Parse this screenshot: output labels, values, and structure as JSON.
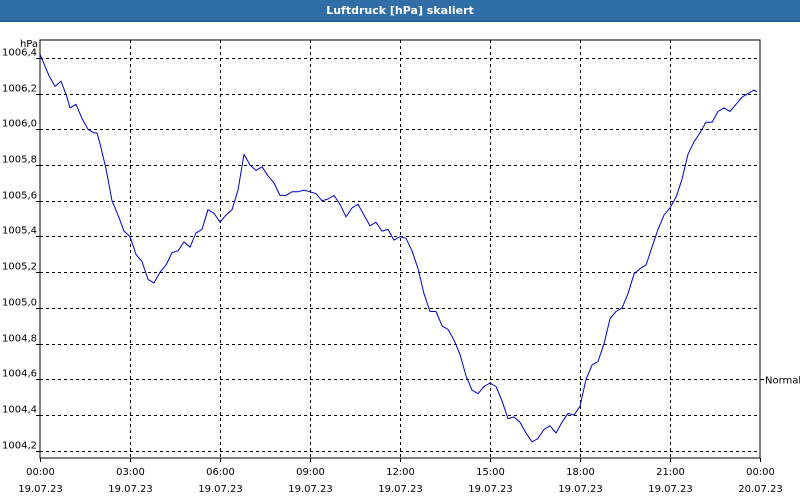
{
  "chart_data": {
    "type": "line",
    "title": "Luftdruck [hPa] skaliert",
    "ylabel": "hPa",
    "xlabel": "",
    "ylim": [
      1004.16,
      1006.5
    ],
    "xlim": [
      0,
      24
    ],
    "grid": true,
    "x_ticks": [
      {
        "t": 0,
        "time": "00:00",
        "date": "19.07.23"
      },
      {
        "t": 3,
        "time": "03:00",
        "date": "19.07.23"
      },
      {
        "t": 6,
        "time": "06:00",
        "date": "19.07.23"
      },
      {
        "t": 9,
        "time": "09:00",
        "date": "19.07.23"
      },
      {
        "t": 12,
        "time": "12:00",
        "date": "19.07.23"
      },
      {
        "t": 15,
        "time": "15:00",
        "date": "19.07.23"
      },
      {
        "t": 18,
        "time": "18:00",
        "date": "19.07.23"
      },
      {
        "t": 21,
        "time": "21:00",
        "date": "19.07.23"
      },
      {
        "t": 24,
        "time": "00:00",
        "date": "20.07.23"
      }
    ],
    "y_ticks": [
      {
        "v": 1004.2,
        "label": "1004,2"
      },
      {
        "v": 1004.4,
        "label": "1004,4"
      },
      {
        "v": 1004.6,
        "label": "1004,6"
      },
      {
        "v": 1004.8,
        "label": "1004,8"
      },
      {
        "v": 1005.0,
        "label": "1005,0"
      },
      {
        "v": 1005.2,
        "label": "1005,2"
      },
      {
        "v": 1005.4,
        "label": "1005,4"
      },
      {
        "v": 1005.6,
        "label": "1005,6"
      },
      {
        "v": 1005.8,
        "label": "1005,8"
      },
      {
        "v": 1006.0,
        "label": "1006,0"
      },
      {
        "v": 1006.2,
        "label": "1006,2"
      },
      {
        "v": 1006.4,
        "label": "1006,4"
      }
    ],
    "reference_line": {
      "value": 1004.6,
      "label": "Normal"
    },
    "series": [
      {
        "color": "#0000cc",
        "x": [
          0.0,
          0.1,
          0.3,
          0.5,
          0.7,
          0.9,
          1.0,
          1.2,
          1.4,
          1.6,
          1.8,
          1.9,
          2.0,
          2.2,
          2.4,
          2.6,
          2.8,
          3.0,
          3.2,
          3.4,
          3.6,
          3.8,
          4.0,
          4.2,
          4.4,
          4.6,
          4.8,
          5.0,
          5.2,
          5.4,
          5.6,
          5.8,
          6.0,
          6.2,
          6.4,
          6.6,
          6.8,
          7.0,
          7.2,
          7.4,
          7.6,
          7.8,
          8.0,
          8.2,
          8.4,
          8.6,
          8.8,
          9.0,
          9.2,
          9.4,
          9.6,
          9.8,
          10.0,
          10.2,
          10.4,
          10.6,
          10.8,
          11.0,
          11.2,
          11.4,
          11.6,
          11.8,
          12.0,
          12.2,
          12.4,
          12.6,
          12.8,
          13.0,
          13.2,
          13.4,
          13.6,
          13.8,
          14.0,
          14.2,
          14.4,
          14.6,
          14.8,
          15.0,
          15.2,
          15.4,
          15.6,
          15.8,
          16.0,
          16.2,
          16.4,
          16.6,
          16.8,
          17.0,
          17.2,
          17.4,
          17.6,
          17.8,
          18.0,
          18.2,
          18.4,
          18.6,
          18.8,
          19.0,
          19.2,
          19.4,
          19.6,
          19.8,
          20.0,
          20.2,
          20.4,
          20.6,
          20.8,
          21.0,
          21.2,
          21.4,
          21.6,
          21.8,
          22.0,
          22.2,
          22.4,
          22.6,
          22.8,
          23.0,
          23.2,
          23.4,
          23.6,
          23.8,
          23.9
        ],
        "values": [
          1006.42,
          1006.38,
          1006.3,
          1006.24,
          1006.27,
          1006.18,
          1006.12,
          1006.14,
          1006.06,
          1006.0,
          1005.98,
          1005.98,
          1005.92,
          1005.78,
          1005.6,
          1005.52,
          1005.43,
          1005.4,
          1005.3,
          1005.26,
          1005.16,
          1005.14,
          1005.2,
          1005.24,
          1005.31,
          1005.32,
          1005.37,
          1005.34,
          1005.42,
          1005.44,
          1005.55,
          1005.53,
          1005.48,
          1005.52,
          1005.55,
          1005.66,
          1005.86,
          1005.8,
          1005.77,
          1005.79,
          1005.74,
          1005.7,
          1005.63,
          1005.63,
          1005.65,
          1005.65,
          1005.66,
          1005.65,
          1005.64,
          1005.6,
          1005.61,
          1005.63,
          1005.58,
          1005.51,
          1005.56,
          1005.58,
          1005.52,
          1005.46,
          1005.48,
          1005.43,
          1005.44,
          1005.38,
          1005.4,
          1005.39,
          1005.32,
          1005.22,
          1005.08,
          1004.98,
          1004.98,
          1004.9,
          1004.88,
          1004.82,
          1004.74,
          1004.62,
          1004.54,
          1004.52,
          1004.56,
          1004.58,
          1004.56,
          1004.48,
          1004.38,
          1004.39,
          1004.36,
          1004.3,
          1004.25,
          1004.27,
          1004.32,
          1004.34,
          1004.3,
          1004.36,
          1004.41,
          1004.4,
          1004.45,
          1004.6,
          1004.68,
          1004.7,
          1004.8,
          1004.94,
          1004.98,
          1005.0,
          1005.08,
          1005.19,
          1005.22,
          1005.24,
          1005.34,
          1005.44,
          1005.52,
          1005.56,
          1005.62,
          1005.72,
          1005.86,
          1005.93,
          1005.98,
          1006.04,
          1006.04,
          1006.1,
          1006.12,
          1006.1,
          1006.14,
          1006.18,
          1006.2,
          1006.22,
          1006.21
        ]
      }
    ]
  }
}
